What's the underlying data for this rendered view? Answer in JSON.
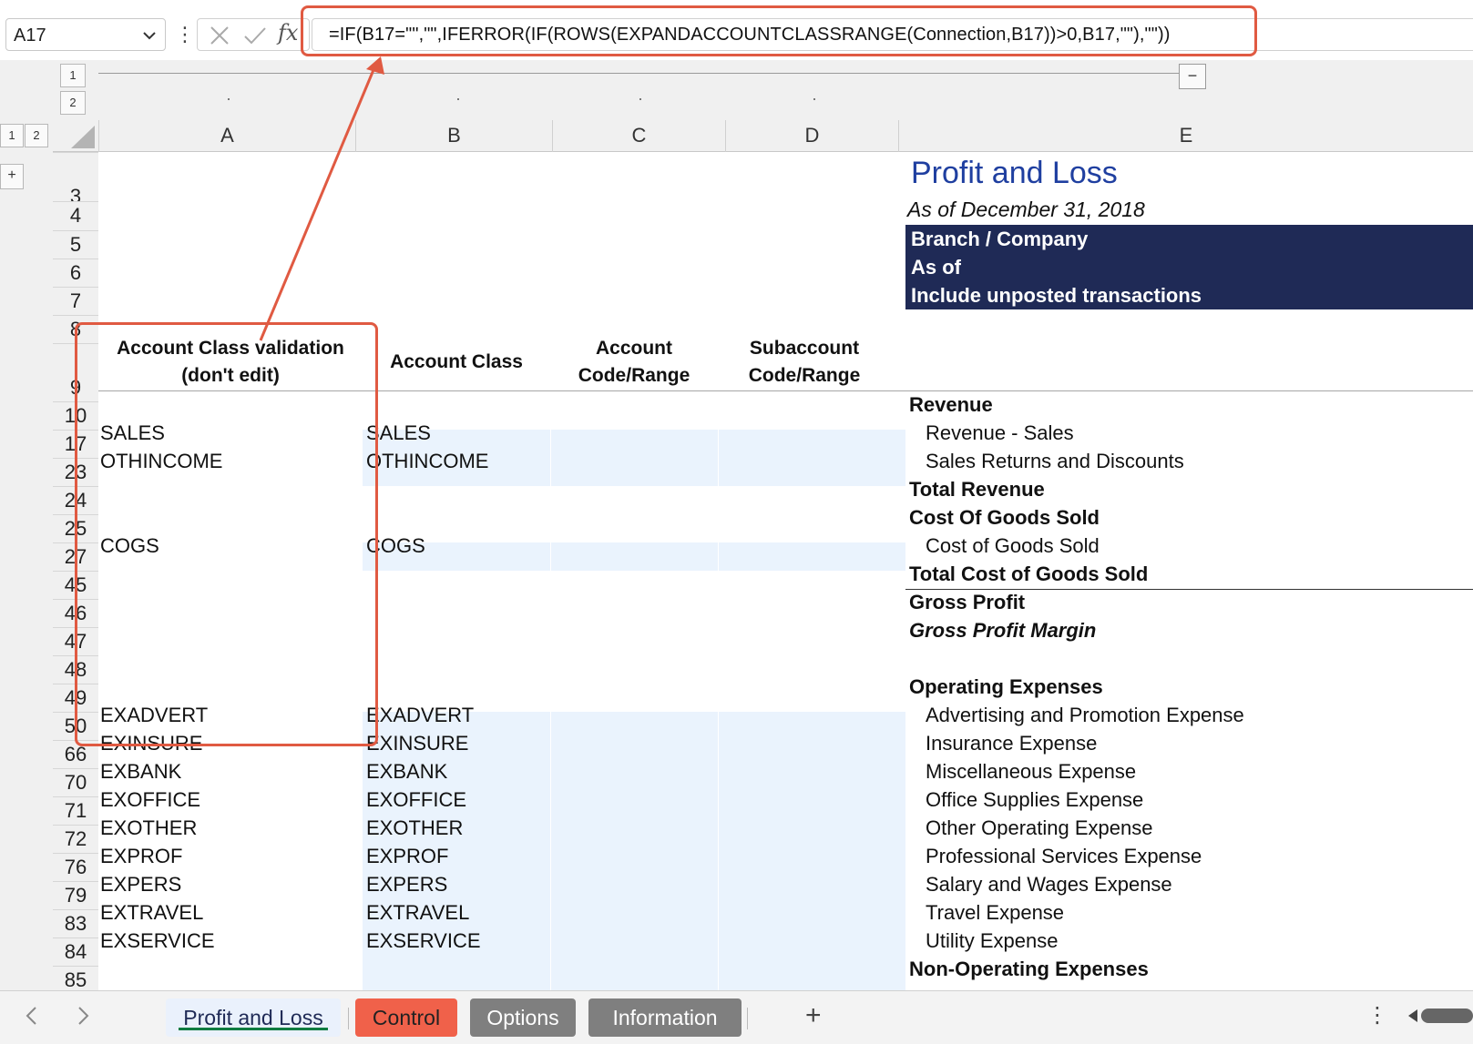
{
  "name_box": {
    "value": "A17"
  },
  "formula_bar": {
    "fx_label": "fx",
    "formula": "=IF(B17=\"\",\"\",IFERROR(IF(ROWS(EXPANDACCOUNTCLASSRANGE(Connection,B17))>0,B17,\"\"),\"\"))"
  },
  "outline": {
    "column_levels": [
      "1",
      "2"
    ],
    "row_levels": [
      "1",
      "2"
    ],
    "collapse_label": "−",
    "expand_label": "+"
  },
  "columns": [
    "A",
    "B",
    "C",
    "D",
    "E"
  ],
  "rows": [
    "3",
    "4",
    "5",
    "6",
    "7",
    "8",
    "9",
    "10",
    "17",
    "23",
    "24",
    "25",
    "27",
    "45",
    "46",
    "47",
    "48",
    "49",
    "50",
    "66",
    "70",
    "71",
    "72",
    "76",
    "79",
    "83",
    "84",
    "85"
  ],
  "report": {
    "title": "Profit and Loss",
    "as_of_line": "As of December 31, 2018",
    "params": [
      "Branch / Company",
      "As of",
      "Include unposted transactions"
    ],
    "header_a_line1": "Account Class validation",
    "header_a_line2": "(don't edit)",
    "header_b": "Account Class",
    "header_c_line1": "Account",
    "header_c_line2": "Code/Range",
    "header_d_line1": "Subaccount",
    "header_d_line2": "Code/Range"
  },
  "col_a": {
    "r17": "SALES",
    "r23": "OTHINCOME",
    "r27": "COGS",
    "r50": "EXADVERT",
    "r66": "EXINSURE",
    "r70": "EXBANK",
    "r71": "EXOFFICE",
    "r72": "EXOTHER",
    "r76": "EXPROF",
    "r79": "EXPERS",
    "r83": "EXTRAVEL",
    "r84": "EXSERVICE"
  },
  "col_b": {
    "r17": "SALES",
    "r23": "OTHINCOME",
    "r27": "COGS",
    "r50": "EXADVERT",
    "r66": "EXINSURE",
    "r70": "EXBANK",
    "r71": "EXOFFICE",
    "r72": "EXOTHER",
    "r76": "EXPROF",
    "r79": "EXPERS",
    "r83": "EXTRAVEL",
    "r84": "EXSERVICE"
  },
  "col_e": {
    "r10": "Revenue",
    "r17": "Revenue - Sales",
    "r23": "Sales Returns and Discounts",
    "r24": "Total Revenue",
    "r25": "Cost Of Goods Sold",
    "r27": "Cost of Goods Sold",
    "r45": "Total Cost of Goods Sold",
    "r46": "Gross Profit",
    "r47": "Gross Profit Margin",
    "r49": "Operating Expenses",
    "r50": "Advertising and Promotion Expense",
    "r66": "Insurance Expense",
    "r70": "Miscellaneous Expense",
    "r71": "Office Supplies Expense",
    "r72": "Other Operating Expense",
    "r76": "Professional Services Expense",
    "r79": "Salary and Wages Expense",
    "r83": "Travel Expense",
    "r84": "Utility Expense",
    "r85": "Non-Operating Expenses"
  },
  "sheet_tabs": [
    "Profit and Loss",
    "Control",
    "Options",
    "Information"
  ],
  "tab_bar": {
    "add_label": "+",
    "more_label": "⋮"
  },
  "colors": {
    "header_navy": "#1f2a56",
    "title_blue": "#1f3fa0",
    "input_fill": "#eaf3fd",
    "highlight_red": "#e05a42",
    "control_tab": "#f0614a",
    "grey_tab": "#7f7f7f"
  }
}
